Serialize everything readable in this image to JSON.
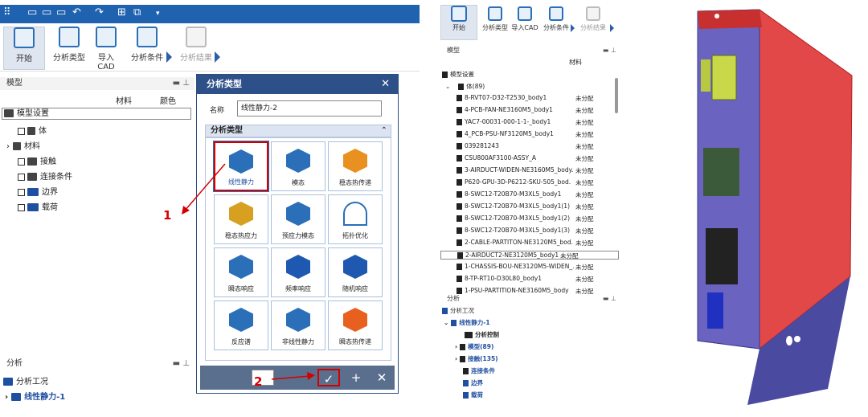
{
  "left": {
    "ribbon": {
      "items": [
        "开始",
        "分析类型",
        "导入CAD",
        "分析条件",
        "分析结果"
      ]
    },
    "model_panel": {
      "title": "模型",
      "col_material": "材料",
      "col_color": "颜色",
      "rows": [
        "模型设置",
        "体",
        "材料",
        "接触",
        "连接条件",
        "边界",
        "载荷"
      ]
    },
    "analysis_panel": {
      "title": "分析",
      "rows": [
        "分析工况",
        "线性静力-1"
      ]
    }
  },
  "dialog": {
    "title": "分析类型",
    "name_label": "名称",
    "name_value": "线性静力-2",
    "section_label": "分析类型",
    "types": [
      "线性静力",
      "模态",
      "稳态热传递",
      "稳态热应力",
      "预应力模态",
      "拓扑优化",
      "瞬态响应",
      "频率响应",
      "随机响应",
      "反应谱",
      "非线性静力",
      "瞬态热传递"
    ],
    "ok_symbol": "✓",
    "add_symbol": "+",
    "close_symbol": "✕"
  },
  "callouts": [
    "1",
    "2"
  ],
  "middle": {
    "ribbon": {
      "items": [
        "开始",
        "分析类型",
        "导入CAD",
        "分析条件",
        "分析结果"
      ]
    },
    "model_panel": {
      "title": "模型",
      "col_material": "材料",
      "settings": "模型设置",
      "body_group": "体(89)",
      "bodies": [
        "8-RVT07-D32-T2530_body1",
        "4-PCB-FAN-NE3160M5_body1",
        "YAC7-00031-000-1-1-_body1",
        "4_PCB-PSU-NF3120M5_body1",
        "039281243",
        "CSU800AF3100-ASSY_A",
        "3-AIRDUCT-WIDEN-NE3160M5_body.",
        "P620-GPU-3D-P6212-SKU-505_bod.",
        "8-SWC12-T20B70-M3XL5_body1",
        "8-SWC12-T20B70-M3XL5_body1(1)",
        "8-SWC12-T20B70-M3XL5_body1(2)",
        "8-SWC12-T20B70-M3XL5_body1(3)",
        "2-CABLE-PARTITON-NE3120M5_bod.",
        "2-AIRDUCT2-NE3120M5_body1",
        "1-CHASSIS-BOU-NE3120M5-WIDEN_.",
        "8-TP-RT10-D30L80_body1",
        "1-PSU-PARTITION-NE3160M5_body"
      ],
      "status": "未分配"
    },
    "analysis_panel": {
      "title": "分析",
      "rows": [
        "分析工况",
        "线性静力-1",
        "分析控制",
        "模型(89)",
        "接触(135)",
        "连接条件",
        "边界",
        "载荷"
      ]
    }
  },
  "colors": {
    "accent": "#1f62b0",
    "dialog_title": "#2e5088",
    "callout": "#d40000",
    "chassis_red": "#e04848",
    "chassis_blue": "#5a5fb8"
  }
}
